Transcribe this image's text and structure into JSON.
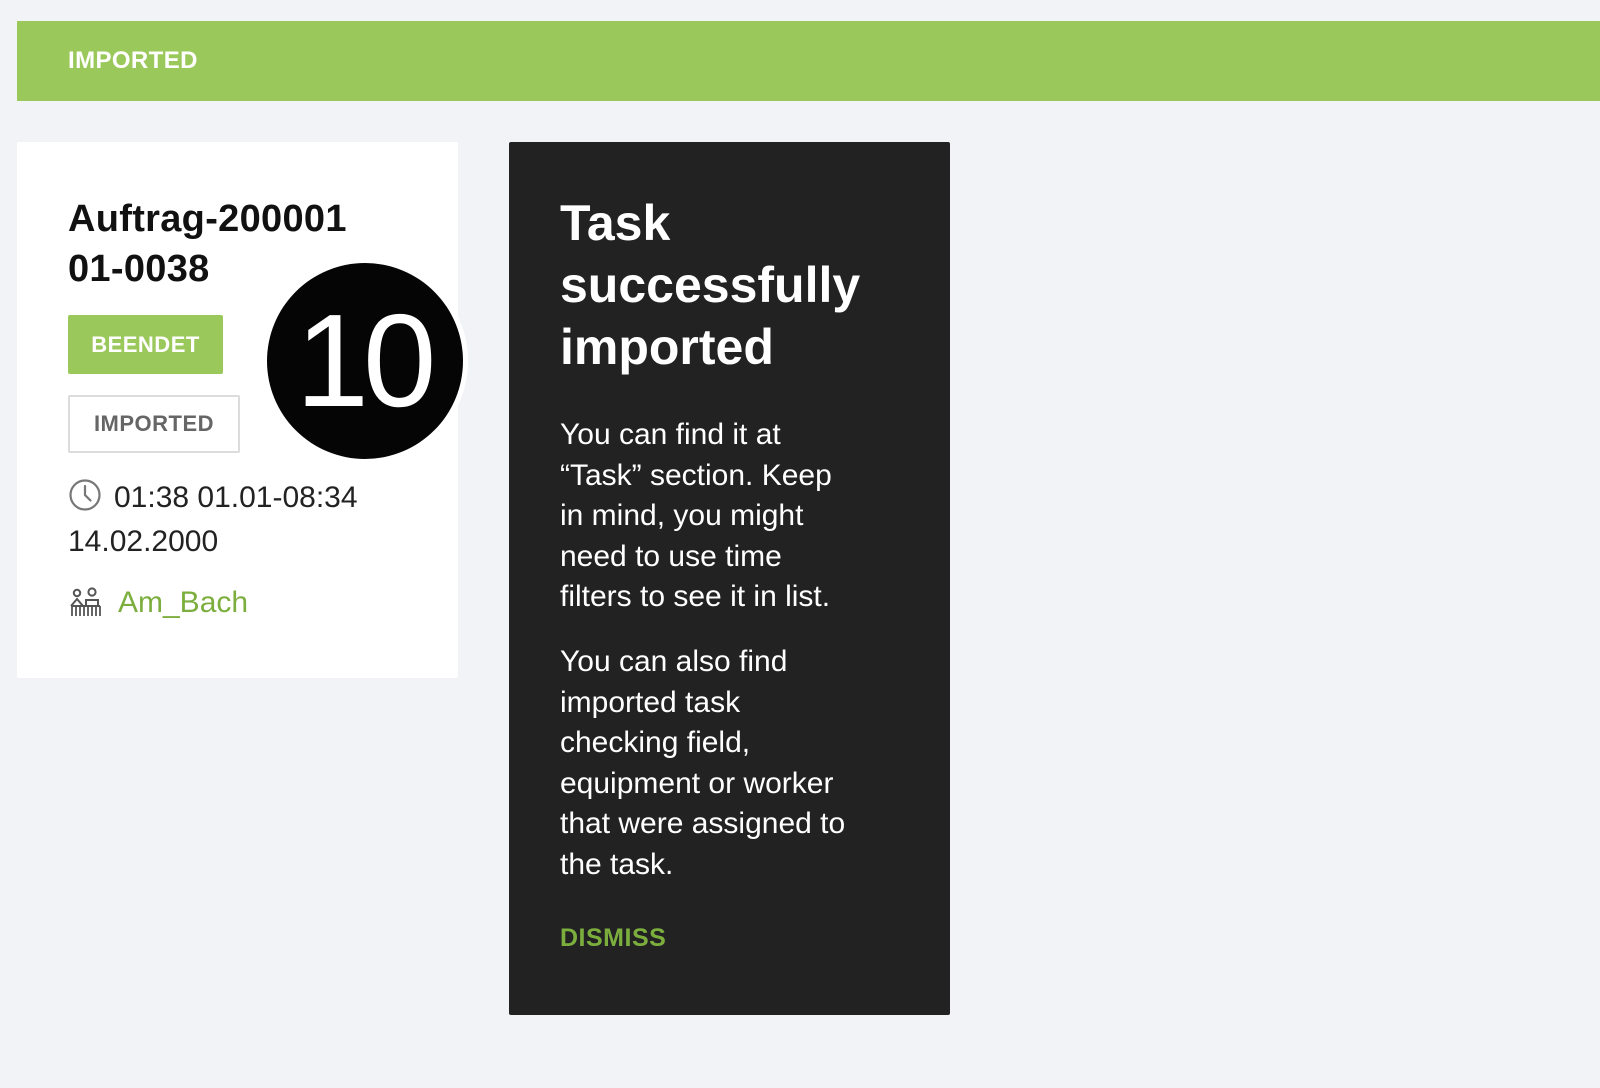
{
  "banner": {
    "label": "IMPORTED",
    "color": "#9bc85b"
  },
  "task_card": {
    "title": "Auftrag-200001\n01-0038",
    "status_chip": "BEENDET",
    "source_chip": "IMPORTED",
    "time_icon": "clock-icon",
    "time_range": "01:38 01.01-08:34\n14.02.2000",
    "field_icon": "field-people-icon",
    "field_name": "Am_Bach"
  },
  "step_badge": {
    "number": "10"
  },
  "popover": {
    "title": "Task\nsuccessfully\nimported",
    "paragraph_1": "You can find it at\n“Task” section. Keep\nin mind, you might\nneed to use time\nfilters to see it in list.",
    "paragraph_2": "You can also find\nimported task\nchecking field,\nequipment or worker\nthat were assigned to\nthe task.",
    "dismiss_label": "DISMISS",
    "background": "#222222",
    "accent": "#7cae3e"
  }
}
